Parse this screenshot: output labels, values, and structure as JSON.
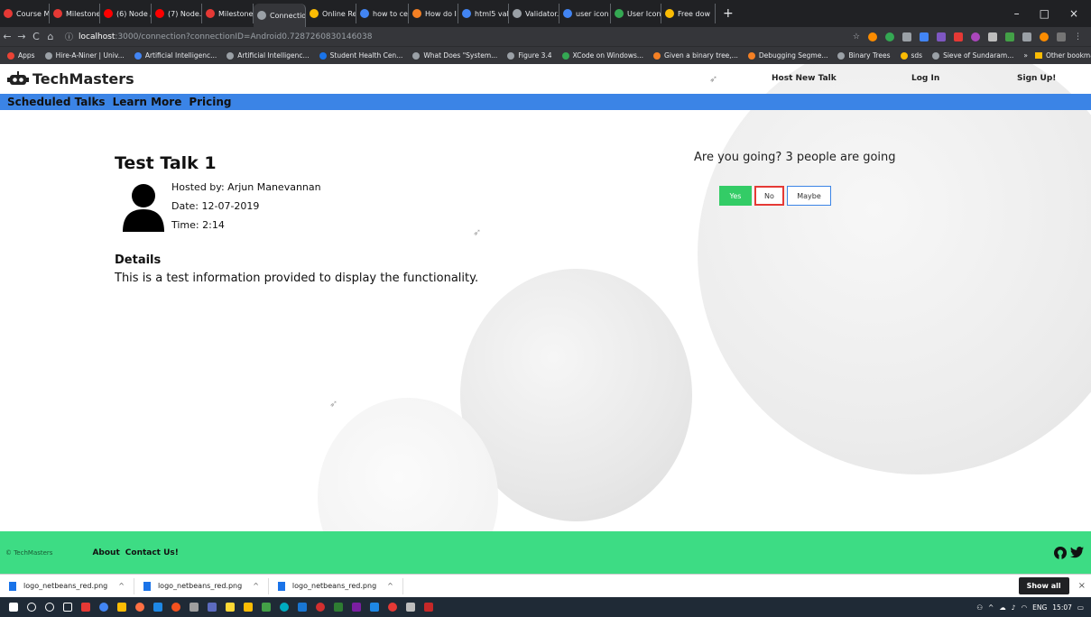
{
  "browser": {
    "tabs": [
      {
        "label": "Course Mi",
        "color": "#e53935"
      },
      {
        "label": "Milestone",
        "color": "#e53935"
      },
      {
        "label": "(6) Node /",
        "color": "#ff0000"
      },
      {
        "label": "(7) Node.j",
        "color": "#ff0000"
      },
      {
        "label": "Milestone",
        "color": "#e53935"
      },
      {
        "label": "Connectio",
        "color": "#9aa0a6",
        "active": true
      },
      {
        "label": "Online Re",
        "color": "#fbbc04"
      },
      {
        "label": "how to ce",
        "color": "#4285f4"
      },
      {
        "label": "How do I",
        "color": "#f48024"
      },
      {
        "label": "html5 vali",
        "color": "#4285f4"
      },
      {
        "label": "Validator.",
        "color": "#9aa0a6"
      },
      {
        "label": "user icon",
        "color": "#4285f4"
      },
      {
        "label": "User Icon",
        "color": "#34a853"
      },
      {
        "label": "Free dow",
        "color": "#fbbc04"
      }
    ],
    "tab_close": "×",
    "new_tab": "+",
    "window_controls": [
      "–",
      "□",
      "×"
    ],
    "url_host": "localhost",
    "url_path": ":3000/connection?connectionID=Android0.7287260830146038",
    "nav": [
      "←",
      "→",
      "C",
      "⌂"
    ],
    "bookmarks": [
      "Apps",
      "Hire-A-Niner | Univ...",
      "Artificial Intelligenc...",
      "Artificial Intelligenc...",
      "Student Health Cen...",
      "What Does \"System...",
      "Figure 3.4",
      "XCode on Windows...",
      "Given a binary tree,...",
      "Debugging Segme...",
      "Binary Trees",
      "sds",
      "Sieve of Sundaram..."
    ],
    "bookmarks_overflow": "»",
    "other_bookmarks": "Other bookmarks"
  },
  "site": {
    "logo_text": "TechMasters",
    "nav": {
      "host": "Host New Talk",
      "login": "Log In",
      "signup": "Sign Up!"
    },
    "subnav": [
      "Scheduled Talks",
      "Learn More",
      "Pricing"
    ]
  },
  "talk": {
    "title": "Test Talk 1",
    "host": "Hosted by: Arjun Manevannan",
    "date": "Date: 12-07-2019",
    "time": "Time: 2:14",
    "details_heading": "Details",
    "details_text": "This is a test information provided to display the functionality."
  },
  "rsvp": {
    "question": "Are you going? 3 people are going",
    "yes": "Yes",
    "no": "No",
    "maybe": "Maybe",
    "colors": {
      "yes": "#33cc66",
      "no": "#e53935",
      "maybe": "#3b84e6"
    }
  },
  "footer": {
    "copyright": "© TechMasters",
    "about": "About",
    "contact": "Contact Us!",
    "color": "#3ddc84"
  },
  "downloads": {
    "items": [
      "logo_netbeans_red.png",
      "logo_netbeans_red.png",
      "logo_netbeans_red.png"
    ],
    "show_all": "Show all",
    "close": "×"
  },
  "taskbar": {
    "lang": "ENG",
    "time": "15:07"
  }
}
